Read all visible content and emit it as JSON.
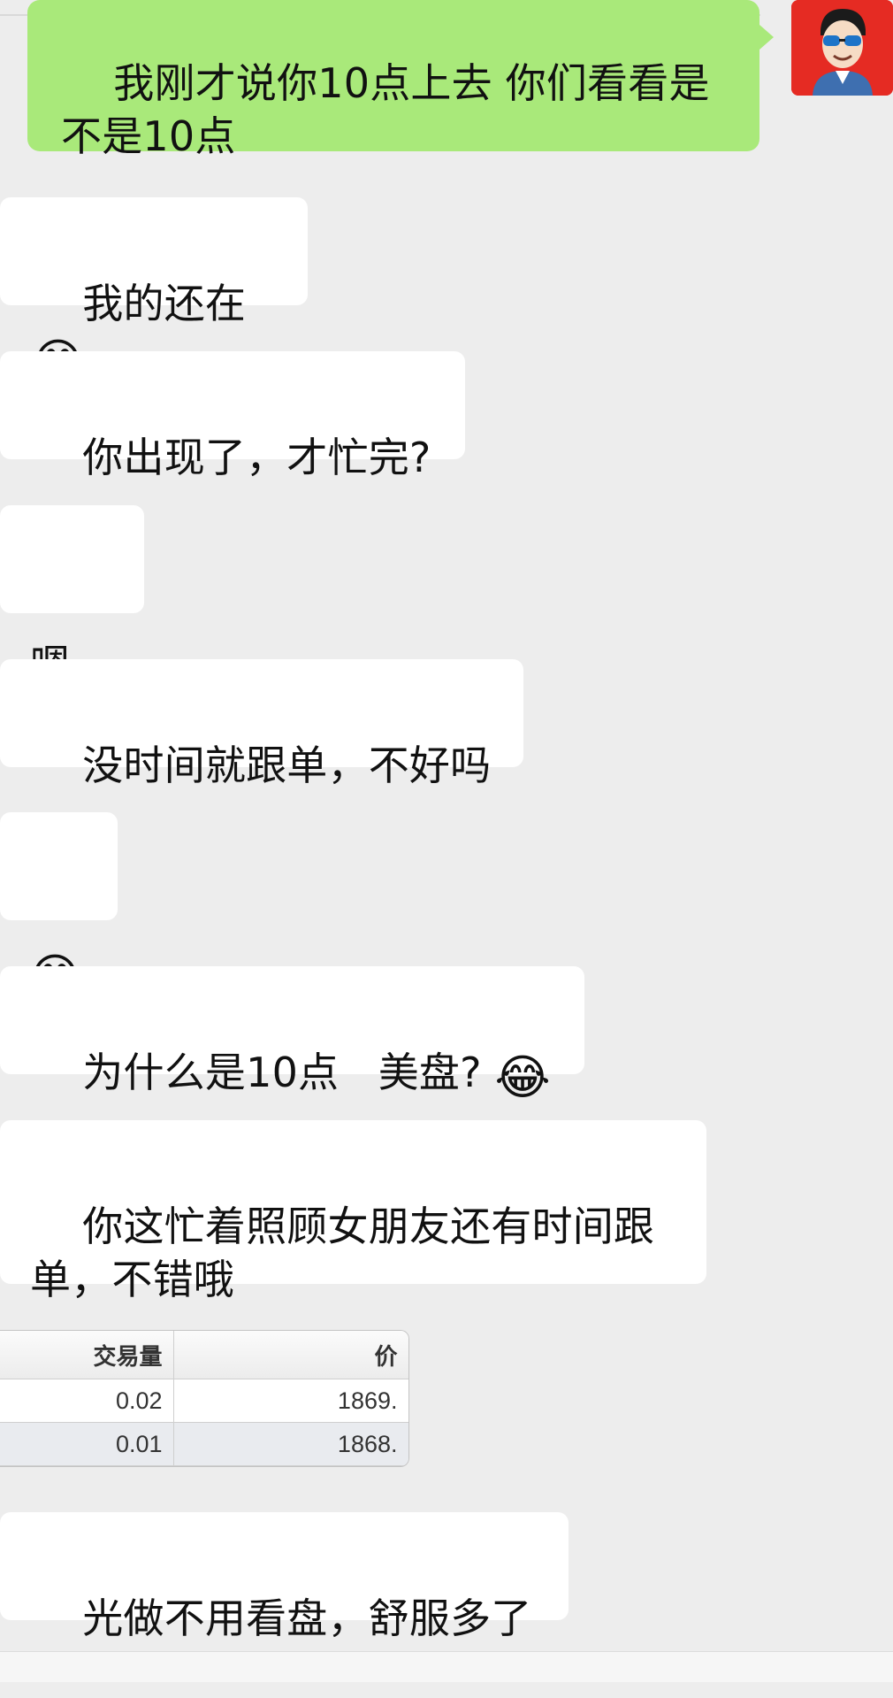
{
  "messages": [
    {
      "side": "out",
      "text": "我刚才说你10点上去 你们看看是\n不是10点"
    },
    {
      "side": "in",
      "text": "我的还在",
      "emoji": "😂"
    },
    {
      "side": "in",
      "text": "你出现了，才忙完?"
    },
    {
      "side": "in",
      "text": "嗯。"
    },
    {
      "side": "in",
      "text": "没时间就跟单，不好吗"
    },
    {
      "side": "in",
      "text": "",
      "emoji": "😁"
    },
    {
      "side": "in",
      "text": "为什么是10点   美盘? ",
      "emoji": "😂"
    },
    {
      "side": "in",
      "text": "你这忙着照顾女朋友还有时间跟\n单，不错哦"
    },
    {
      "side": "in",
      "text": "光做不用看盘，舒服多了"
    }
  ],
  "trade_table": {
    "headers": [
      "交易量",
      "价"
    ],
    "rows": [
      [
        "0.02",
        "1869."
      ],
      [
        "0.01",
        "1868."
      ]
    ]
  },
  "avatar": {
    "icon": "cartoon-man-sunglasses-avatar",
    "background": "#e52b23"
  },
  "colors": {
    "chat_background": "#ededed",
    "outgoing_bubble": "#a9e97a",
    "incoming_bubble": "#ffffff"
  }
}
